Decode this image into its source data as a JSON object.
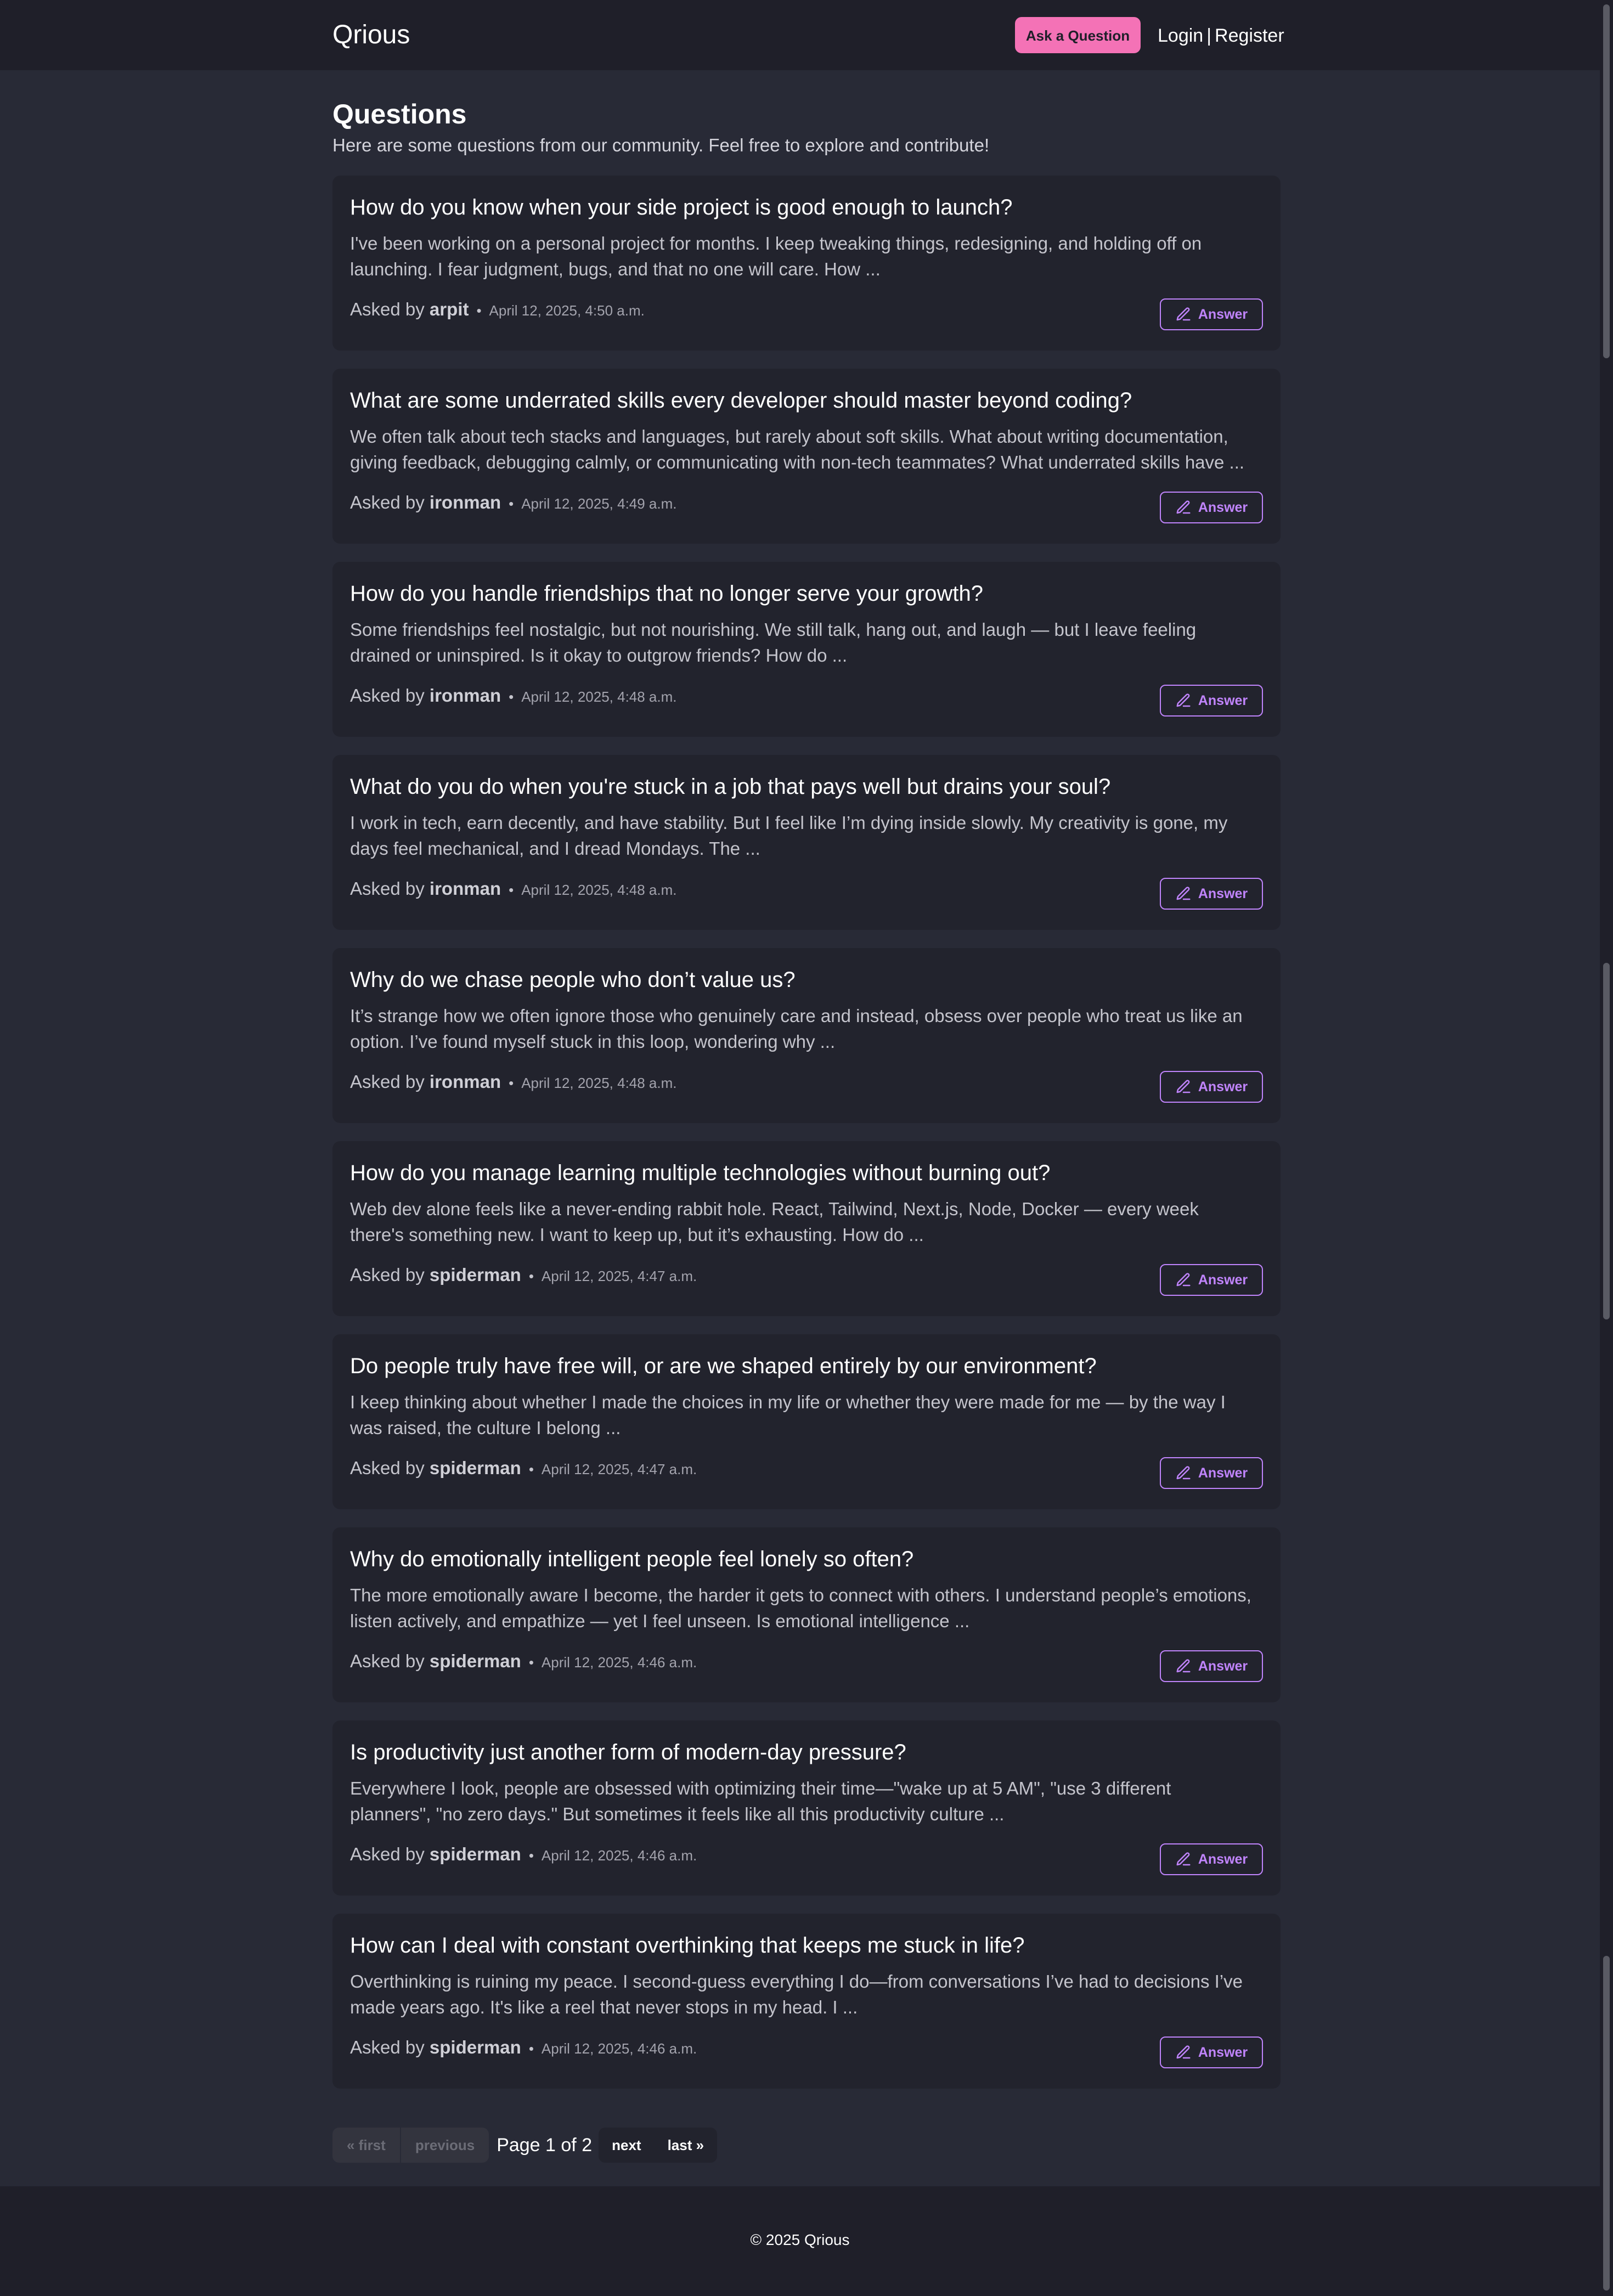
{
  "header": {
    "brand": "Qrious",
    "ask_button": "Ask a Question",
    "login": "Login",
    "separator": "|",
    "register": "Register"
  },
  "main": {
    "title": "Questions",
    "subtitle": "Here are some questions from our community. Feel free to explore and contribute!"
  },
  "meta_prefix": "Asked by",
  "meta_dot": "•",
  "answer_label": "Answer",
  "answer_icon": "pencil-icon",
  "questions": [
    {
      "title": "How do you know when your side project is good enough to launch?",
      "excerpt": "I've been working on a personal project for months. I keep tweaking things, redesigning, and holding off on launching. I fear judgment, bugs, and that no one will care. How ...",
      "author": "arpit",
      "date": "April 12, 2025, 4:50 a.m."
    },
    {
      "title": "What are some underrated skills every developer should master beyond coding?",
      "excerpt": "We often talk about tech stacks and languages, but rarely about soft skills. What about writing documentation, giving feedback, debugging calmly, or communicating with non-tech teammates? What underrated skills have ...",
      "author": "ironman",
      "date": "April 12, 2025, 4:49 a.m."
    },
    {
      "title": "How do you handle friendships that no longer serve your growth?",
      "excerpt": "Some friendships feel nostalgic, but not nourishing. We still talk, hang out, and laugh — but I leave feeling drained or uninspired. Is it okay to outgrow friends? How do ...",
      "author": "ironman",
      "date": "April 12, 2025, 4:48 a.m."
    },
    {
      "title": "What do you do when you're stuck in a job that pays well but drains your soul?",
      "excerpt": "I work in tech, earn decently, and have stability. But I feel like I’m dying inside slowly. My creativity is gone, my days feel mechanical, and I dread Mondays. The ...",
      "author": "ironman",
      "date": "April 12, 2025, 4:48 a.m."
    },
    {
      "title": "Why do we chase people who don’t value us?",
      "excerpt": "It’s strange how we often ignore those who genuinely care and instead, obsess over people who treat us like an option. I’ve found myself stuck in this loop, wondering why ...",
      "author": "ironman",
      "date": "April 12, 2025, 4:48 a.m."
    },
    {
      "title": "How do you manage learning multiple technologies without burning out?",
      "excerpt": "Web dev alone feels like a never-ending rabbit hole. React, Tailwind, Next.js, Node, Docker — every week there's something new. I want to keep up, but it’s exhausting. How do ...",
      "author": "spiderman",
      "date": "April 12, 2025, 4:47 a.m."
    },
    {
      "title": "Do people truly have free will, or are we shaped entirely by our environment?",
      "excerpt": "I keep thinking about whether I made the choices in my life or whether they were made for me — by the way I was raised, the culture I belong ...",
      "author": "spiderman",
      "date": "April 12, 2025, 4:47 a.m."
    },
    {
      "title": "Why do emotionally intelligent people feel lonely so often?",
      "excerpt": "The more emotionally aware I become, the harder it gets to connect with others. I understand people’s emotions, listen actively, and empathize — yet I feel unseen. Is emotional intelligence ...",
      "author": "spiderman",
      "date": "April 12, 2025, 4:46 a.m."
    },
    {
      "title": "Is productivity just another form of modern-day pressure?",
      "excerpt": "Everywhere I look, people are obsessed with optimizing their time—\"wake up at 5 AM\", \"use 3 different planners\", \"no zero days.\" But sometimes it feels like all this productivity culture ...",
      "author": "spiderman",
      "date": "April 12, 2025, 4:46 a.m."
    },
    {
      "title": "How can I deal with constant overthinking that keeps me stuck in life?",
      "excerpt": "Overthinking is ruining my peace. I second-guess everything I do—from conversations I’ve had to decisions I’ve made years ago. It's like a reel that never stops in my head. I ...",
      "author": "spiderman",
      "date": "April 12, 2025, 4:46 a.m."
    }
  ],
  "pagination": {
    "first": "« first",
    "previous": "previous",
    "current": "Page 1 of 2",
    "next": "next",
    "last": "last »"
  },
  "footer": {
    "copyright": "© 2025 Qrious"
  },
  "colors": {
    "background": "#282a36",
    "navbar": "#1f1f29",
    "card": "#22232d",
    "accent_pink": "#f472b6",
    "accent_purple": "#c084fc"
  }
}
